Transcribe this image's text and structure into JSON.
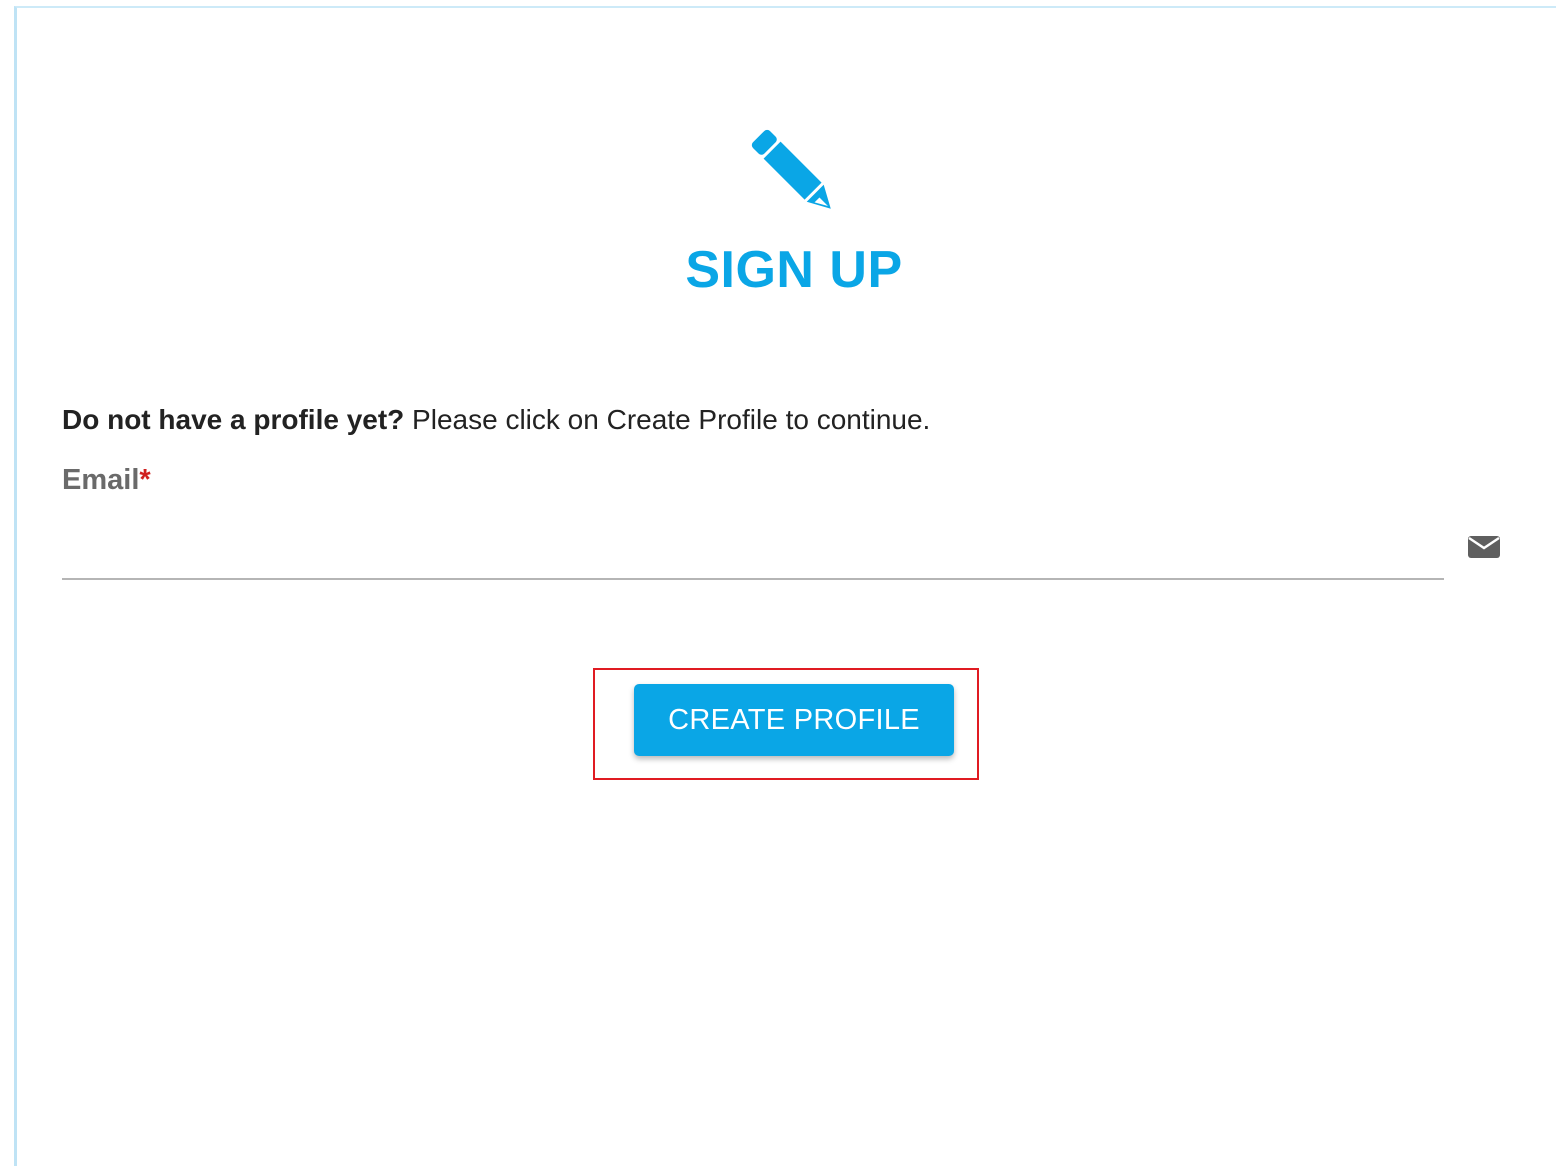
{
  "header": {
    "icon": "pencil-icon",
    "title": "SIGN UP"
  },
  "form": {
    "prompt_bold": "Do not have a profile yet?",
    "prompt_text": " Please click on Create Profile to continue.",
    "email_label": "Email",
    "required_marker": "*",
    "email_value": "",
    "email_icon": "envelope-icon",
    "submit_label": "CREATE PROFILE"
  },
  "colors": {
    "accent": "#0aa6e6",
    "required": "#d0201f",
    "highlight": "#e01b22"
  }
}
